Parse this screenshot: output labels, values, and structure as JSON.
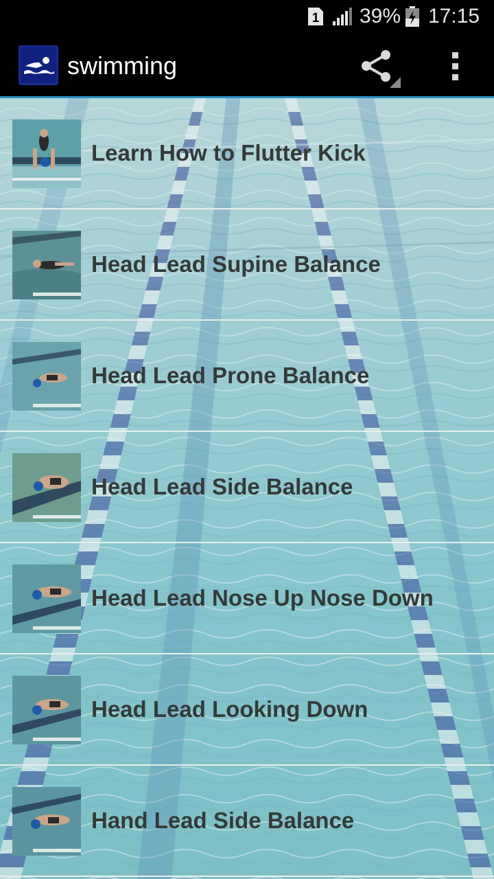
{
  "status_bar": {
    "sim_label": "1",
    "battery_percent": "39%",
    "time": "17:15"
  },
  "app_bar": {
    "title": "swimming",
    "logo_icon": "swimmer-logo-icon",
    "actions": [
      "share-icon",
      "overflow-menu-icon"
    ]
  },
  "colors": {
    "app_bar_bg": "#000000",
    "accent_line": "#2a8ec4",
    "item_text": "#333a3a",
    "divider": "#e8eeee"
  },
  "list": {
    "items": [
      {
        "label": "Learn How to Flutter Kick",
        "thumbnail": "swimmer-underwater-kick"
      },
      {
        "label": "Head Lead Supine Balance",
        "thumbnail": "swimmer-supine"
      },
      {
        "label": "Head Lead Prone Balance",
        "thumbnail": "swimmer-prone"
      },
      {
        "label": "Head Lead Side Balance",
        "thumbnail": "swimmer-side"
      },
      {
        "label": "Head Lead Nose Up Nose Down",
        "thumbnail": "swimmer-nose-up"
      },
      {
        "label": "Head Lead Looking Down",
        "thumbnail": "swimmer-looking-down"
      },
      {
        "label": "Hand Lead Side Balance",
        "thumbnail": "swimmer-hand-lead"
      }
    ]
  }
}
